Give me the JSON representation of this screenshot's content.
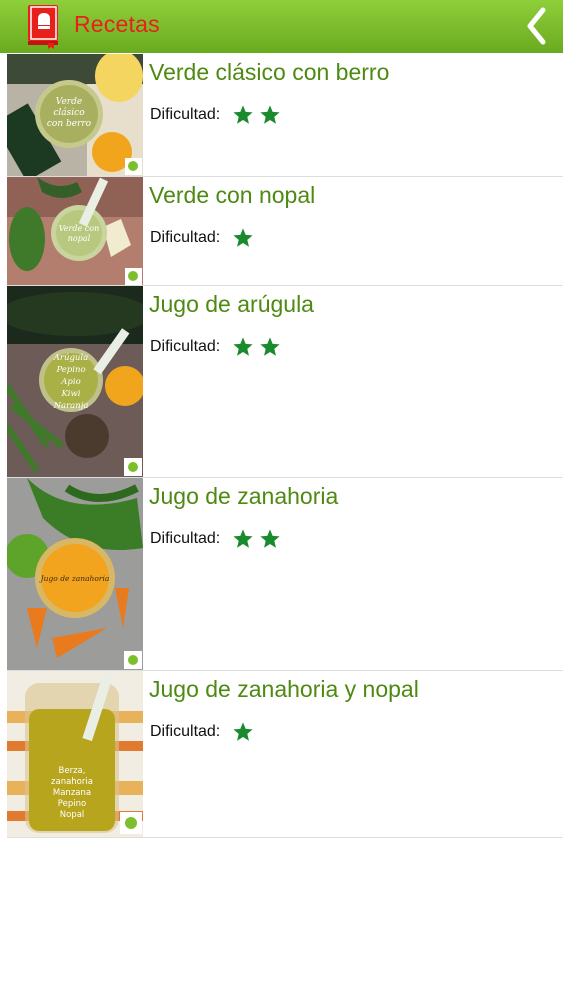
{
  "header": {
    "title": "Recetas"
  },
  "recipes": [
    {
      "title": "Verde clásico con berro",
      "difficulty_label": "Dificultad:",
      "stars": 2,
      "image_text": "Verde clásico con berro"
    },
    {
      "title": "Verde con nopal",
      "difficulty_label": "Dificultad:",
      "stars": 1,
      "image_text": "Verde con nopal"
    },
    {
      "title": "Jugo de arúgula",
      "difficulty_label": "Dificultad:",
      "stars": 2,
      "image_text": "Arúgula Pepino Apio Kiwi Naranja"
    },
    {
      "title": "Jugo de zanahoria",
      "difficulty_label": "Dificultad:",
      "stars": 2,
      "image_text": "Jugo de zanahoria"
    },
    {
      "title": "Jugo de zanahoria y nopal",
      "difficulty_label": "Dificultad:",
      "stars": 1,
      "image_text": "Berza, zanahoria Manzana Pepino Nopal"
    }
  ],
  "colors": {
    "header_green": "#7cbf2c",
    "title_red": "#e8201c",
    "recipe_green": "#4e8a12",
    "star_green": "#1a8a2e"
  }
}
